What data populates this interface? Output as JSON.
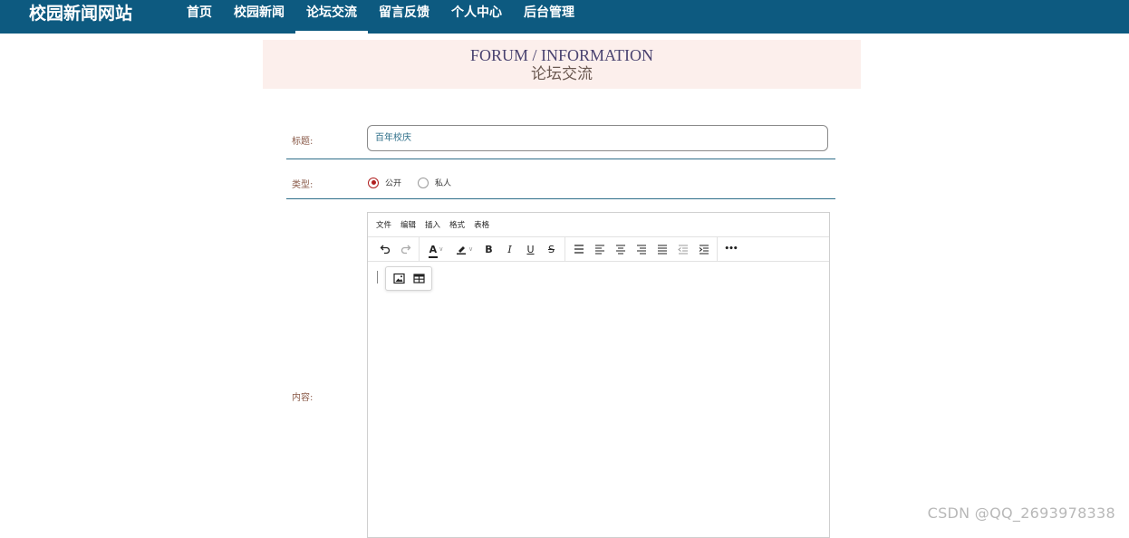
{
  "brand": "校园新闻网站",
  "nav": {
    "items": [
      "首页",
      "校园新闻",
      "论坛交流",
      "留言反馈",
      "个人中心",
      "后台管理"
    ],
    "active": "论坛交流"
  },
  "banner": {
    "en": "FORUM / INFORMATION",
    "cn": "论坛交流"
  },
  "form": {
    "title_label": "标题:",
    "title_value": "百年校庆",
    "type_label": "类型:",
    "type_options": [
      "公开",
      "私人"
    ],
    "type_selected": "公开",
    "content_label": "内容:"
  },
  "editor": {
    "menu": [
      "文件",
      "编辑",
      "插入",
      "格式",
      "表格"
    ],
    "toolbar_icons": [
      "undo-icon",
      "redo-icon",
      "font-color-icon",
      "highlight-color-icon",
      "bold-icon",
      "italic-icon",
      "underline-icon",
      "strikethrough-icon",
      "line-height-icon",
      "align-left-icon",
      "align-center-icon",
      "align-right-icon",
      "align-justify-icon",
      "outdent-icon",
      "indent-icon",
      "more-icon"
    ],
    "toolbar_glyphs": {
      "bold": "B",
      "italic": "I",
      "underline": "U",
      "strikethrough": "S",
      "font_color": "A",
      "more": "•••"
    },
    "quickbar_icons": [
      "image-icon",
      "table-icon"
    ]
  },
  "watermark": "CSDN @QQ_2693978338",
  "colors": {
    "nav_bg": "#0d5a80",
    "banner_bg": "#fcefec",
    "accent_red": "#b02020",
    "divider": "#2f6f8a"
  }
}
